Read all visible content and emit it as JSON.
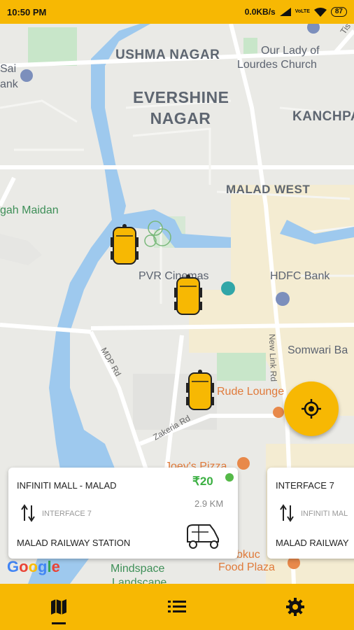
{
  "status_bar": {
    "time": "10:50 PM",
    "network": "0.0KB/s",
    "battery": "87"
  },
  "map": {
    "labels": {
      "ushma_nagar": "USHMA NAGAR",
      "our_lady_1": "Our Lady of",
      "our_lady_2": "Lourdes Church",
      "evershine_1": "EVERSHINE",
      "evershine_2": "NAGAR",
      "kanchpa": "KANCHPA",
      "sai": "Sai",
      "bank_partial": "ank",
      "malad_west": "MALAD WEST",
      "maidan": "gah Maidan",
      "pvr": "PVR Cinemas",
      "hdfc": "HDFC Bank",
      "somwari": "Somwari Ba",
      "mdp_rd": "MDP Rd",
      "new_link_rd": "New Link Rd",
      "rude_lounge": "Rude Lounge",
      "zakeria": "Zakeria Rd",
      "joeys": "Joey's Pizza",
      "mindspace": "Mindspace",
      "landscape": "Landscape",
      "food_plaza": "Food Plaza",
      "bkuc": "bkuc",
      "tis": "Tis"
    },
    "google_logo": "Google"
  },
  "cards": [
    {
      "from": "INFINITI MALL - MALAD",
      "price": "₹20",
      "via": "INTERFACE 7",
      "distance": "2.9 KM",
      "to": "MALAD RAILWAY STATION"
    },
    {
      "from": "INTERFACE 7",
      "via": "INFINITI MAL",
      "to": "MALAD RAILWAY"
    }
  ],
  "bottom_nav": {
    "items": [
      "map-icon",
      "list-icon",
      "settings-icon"
    ]
  },
  "colors": {
    "accent": "#f7b803",
    "price": "#3cb043"
  }
}
